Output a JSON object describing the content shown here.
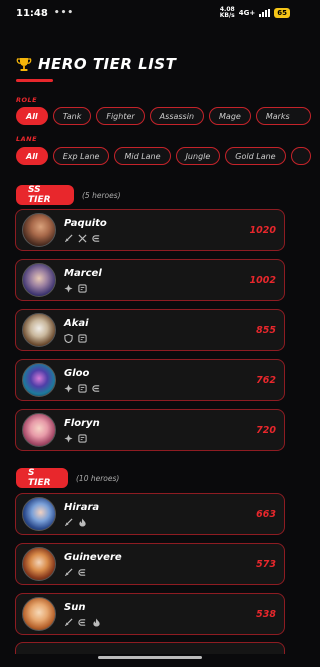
{
  "status_bar": {
    "time": "11:48",
    "net_speed": "4.08",
    "net_unit": "KB/s",
    "signal": "4G+",
    "battery": "65"
  },
  "header": {
    "title": "HERO TIER LIST",
    "icon": "trophy-icon"
  },
  "filters": {
    "role_label": "ROLE",
    "roles": [
      "All",
      "Tank",
      "Fighter",
      "Assassin",
      "Mage",
      "Marks"
    ],
    "lane_label": "LANE",
    "lanes": [
      "All",
      "Exp Lane",
      "Mid Lane",
      "Jungle",
      "Gold Lane"
    ]
  },
  "tiers": [
    {
      "label": "SS TIER",
      "count": "(5 heroes)",
      "heroes": [
        {
          "name": "Paquito",
          "score": "1020",
          "icons": [
            "sword-icon",
            "cross-swords-icon",
            "gold-icon"
          ]
        },
        {
          "name": "Marcel",
          "score": "1002",
          "icons": [
            "compass-icon",
            "swap-icon"
          ]
        },
        {
          "name": "Akai",
          "score": "855",
          "icons": [
            "shield-icon",
            "swap-icon"
          ]
        },
        {
          "name": "Gloo",
          "score": "762",
          "icons": [
            "compass-icon",
            "swap-icon",
            "gold-icon"
          ]
        },
        {
          "name": "Floryn",
          "score": "720",
          "icons": [
            "compass-icon",
            "swap-icon"
          ]
        }
      ]
    },
    {
      "label": "S TIER",
      "count": "(10 heroes)",
      "heroes": [
        {
          "name": "Hirara",
          "score": "663",
          "icons": [
            "sword-icon",
            "flame-icon"
          ]
        },
        {
          "name": "Guinevere",
          "score": "573",
          "icons": [
            "sword-icon",
            "gold-icon"
          ]
        },
        {
          "name": "Sun",
          "score": "538",
          "icons": [
            "sword-icon",
            "gold-icon",
            "flame-icon"
          ]
        }
      ]
    }
  ],
  "colors": {
    "accent": "#e8272c",
    "background": "#0a0a0c",
    "card": "#151515",
    "card_border": "#8e1c22"
  }
}
